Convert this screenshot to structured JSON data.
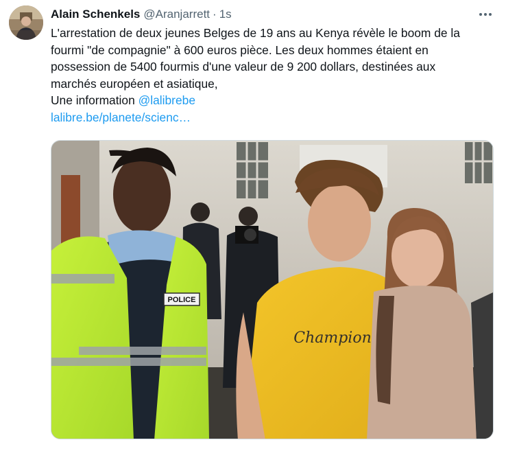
{
  "tweet": {
    "author_name": "Alain Schenkels",
    "author_handle": "@Aranjarrett",
    "separator": "·",
    "timestamp": "1s",
    "more_icon": "more-horizontal-icon",
    "text_lines": [
      "L'arrestation de deux jeunes Belges de 19 ans au Kenya révèle le boom de la",
      "fourmi \"de compagnie\" à 600 euros pièce. Les deux hommes étaient en",
      "possession de 5400 fourmis d'une valeur de 9 200 dollars, destinées aux",
      "marchés européen et asiatique,"
    ],
    "source_prefix": "Une information ",
    "mention": "@lalibrebe",
    "url_text": "lalibre.be/planete/scienc…",
    "media": {
      "vest_label": "POLICE",
      "shirt_label": "Champion"
    }
  },
  "colors": {
    "link": "#1d9bf0",
    "text_primary": "#0f1419",
    "text_secondary": "#536471",
    "border": "#cfd9de"
  }
}
